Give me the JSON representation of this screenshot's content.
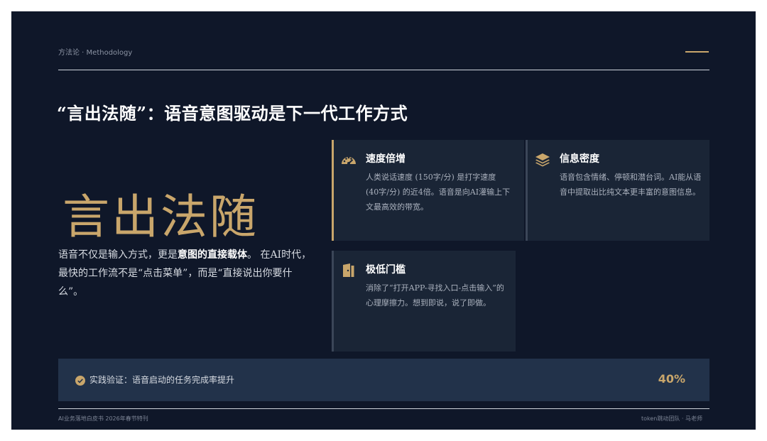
{
  "header": {
    "label": "方法论 · Methodology"
  },
  "title": "“言出法随”：语音意图驱动是下一代工作方式",
  "hero": "言出法随",
  "description": {
    "part1": "语音不仅是输入方式，更是",
    "bold": "意图的直接载体",
    "part2": "。 在AI时代，最快的工作流不是“点击菜单”，而是“直接说出你要什么”。"
  },
  "cards": [
    {
      "icon": "speedometer-icon",
      "title": "速度倍增",
      "body": "人类说话速度 (150字/分) 是打字速度 (40字/分) 的近4倍。语音是向AI灌输上下文最高效的带宽。"
    },
    {
      "icon": "layers-icon",
      "title": "信息密度",
      "body": "语音包含情绪、停顿和潜台词。AI能从语音中提取出比纯文本更丰富的意图信息。"
    },
    {
      "icon": "door-icon",
      "title": "极低门槛",
      "body": "消除了“打开APP-寻找入口-点击输入”的心理摩擦力。想到即说，说了即做。"
    }
  ],
  "banner": {
    "icon": "check-circle-icon",
    "text": "实践验证：语音启动的任务完成率提升",
    "value": "40%"
  },
  "footer": {
    "left": "AI业务落地白皮书 2026年春节特刊",
    "right": "token跳动团队 · 马老师"
  },
  "colors": {
    "background": "#0f1729",
    "accent": "#c9a66b",
    "card": "#1a2536",
    "banner": "#22324a"
  }
}
